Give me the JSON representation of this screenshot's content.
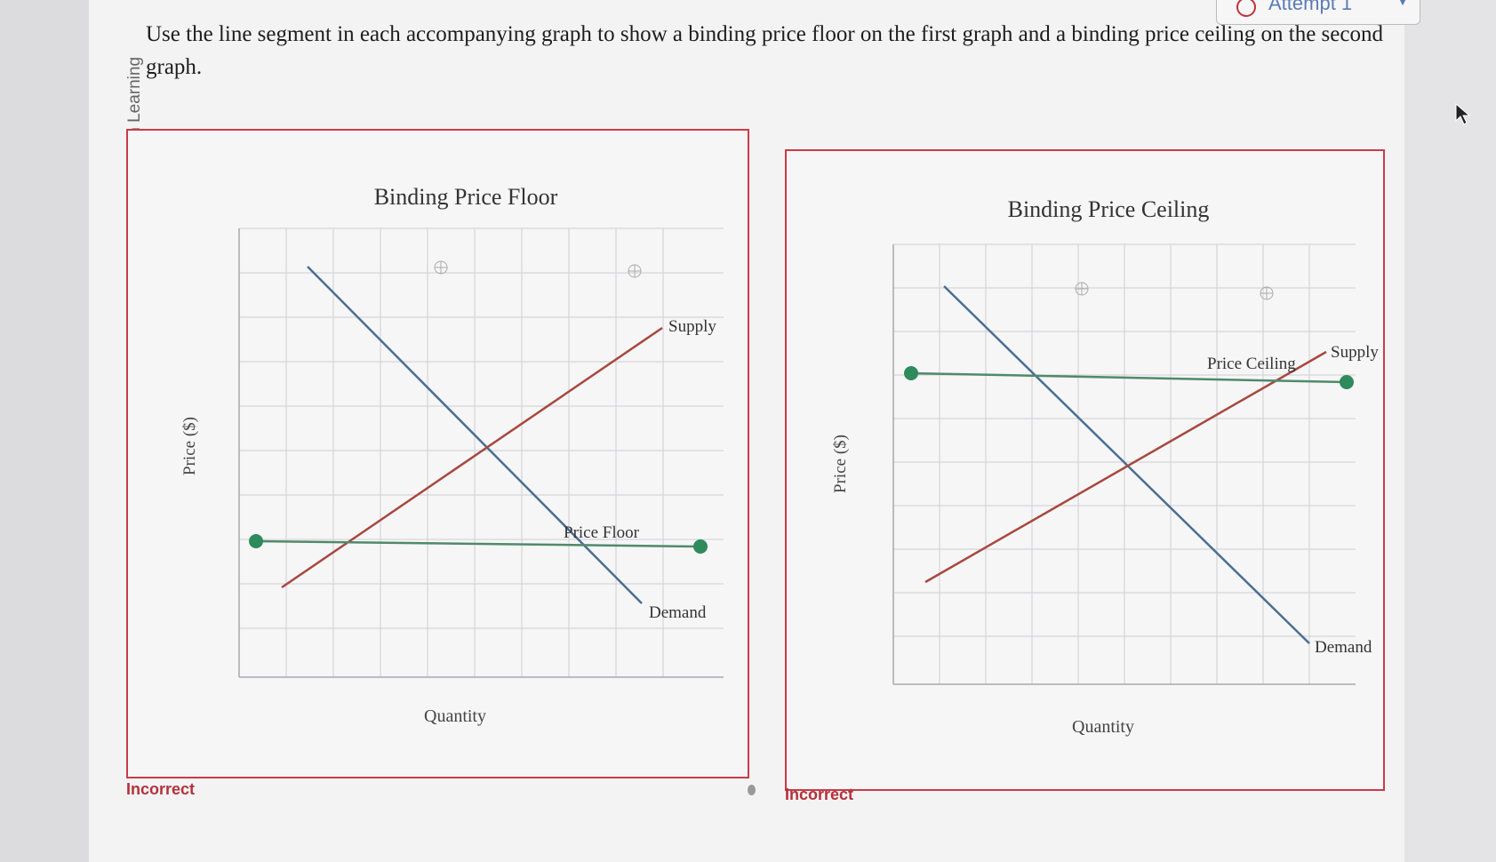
{
  "header": {
    "credit": "© Macmillan Learning",
    "instruction": "Use the line segment in each accompanying graph to show a binding price floor on the first graph and a binding price ceiling on the second graph.",
    "attempt_label": "Attempt 1"
  },
  "graphs": [
    {
      "title": "Binding Price Floor",
      "ylabel": "Price ($)",
      "xlabel": "Quantity",
      "supply_label": "Supply",
      "demand_label": "Demand",
      "segment_label": "Price Floor",
      "status": "Incorrect"
    },
    {
      "title": "Binding Price Ceiling",
      "ylabel": "Price ($)",
      "xlabel": "Quantity",
      "supply_label": "Supply",
      "demand_label": "Demand",
      "segment_label": "Price Ceiling",
      "status": "Incorrect"
    }
  ],
  "colors": {
    "border": "#c83c47",
    "supply": "#a8473e",
    "demand": "#4a6e93",
    "segment": "#4f8a6a",
    "handle": "#2f8a5c",
    "status": "#b3313b"
  }
}
